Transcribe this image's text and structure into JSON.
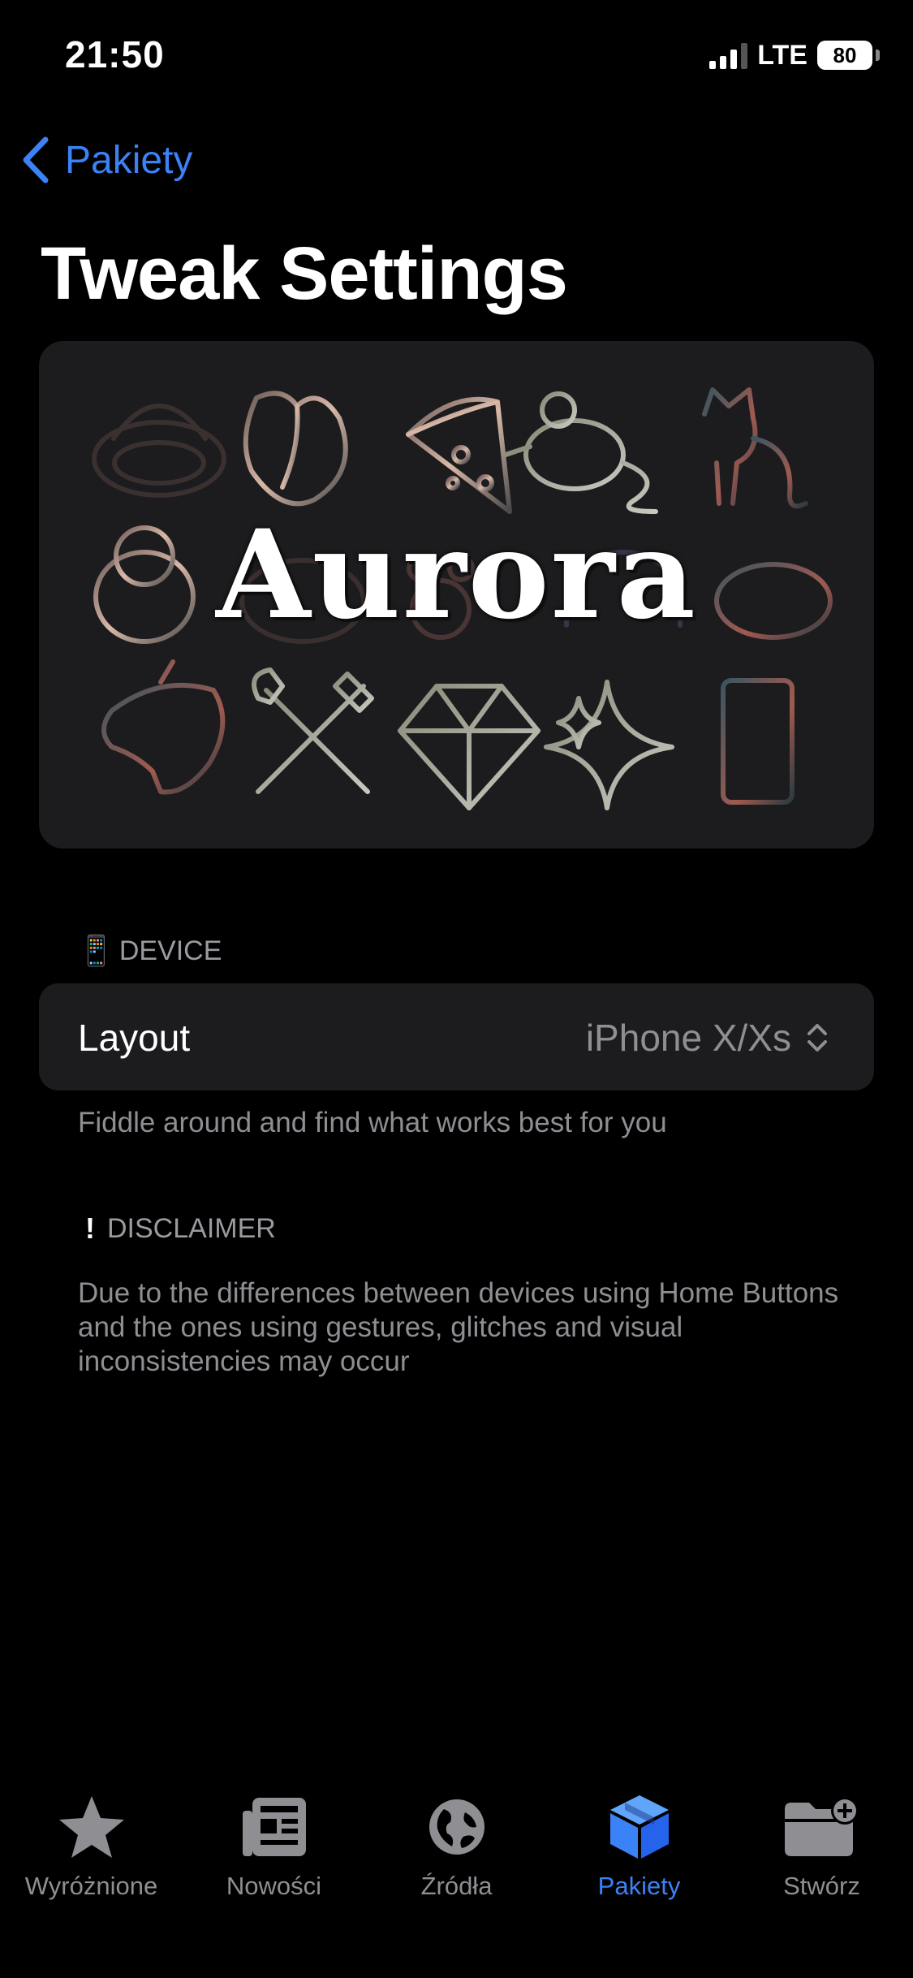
{
  "status": {
    "time": "21:50",
    "network": "LTE",
    "battery": "80"
  },
  "nav": {
    "back_label": "Pakiety"
  },
  "page": {
    "title": "Tweak Settings"
  },
  "banner": {
    "word": "Aurora"
  },
  "device_section": {
    "header": "DEVICE",
    "header_icon": "phone-emoji"
  },
  "layout_cell": {
    "label": "Layout",
    "value": "iPhone X/Xs"
  },
  "device_footer": "Fiddle around and find what works best for you",
  "disclaimer_section": {
    "header": "DISCLAIMER",
    "header_icon": "exclamation-emoji"
  },
  "disclaimer_text": "Due to the differences between devices using Home Buttons and the ones using gestures, glitches and visual inconsistencies may occur",
  "tabbar": {
    "accent": "#3b82f6",
    "tabs": [
      {
        "label": "Wyróżnione",
        "icon": "star-icon"
      },
      {
        "label": "Nowości",
        "icon": "newspaper-icon"
      },
      {
        "label": "Źródła",
        "icon": "globe-icon"
      },
      {
        "label": "Pakiety",
        "icon": "package-icon",
        "active": true
      },
      {
        "label": "Stwórz",
        "icon": "folder-plus-icon"
      }
    ]
  }
}
